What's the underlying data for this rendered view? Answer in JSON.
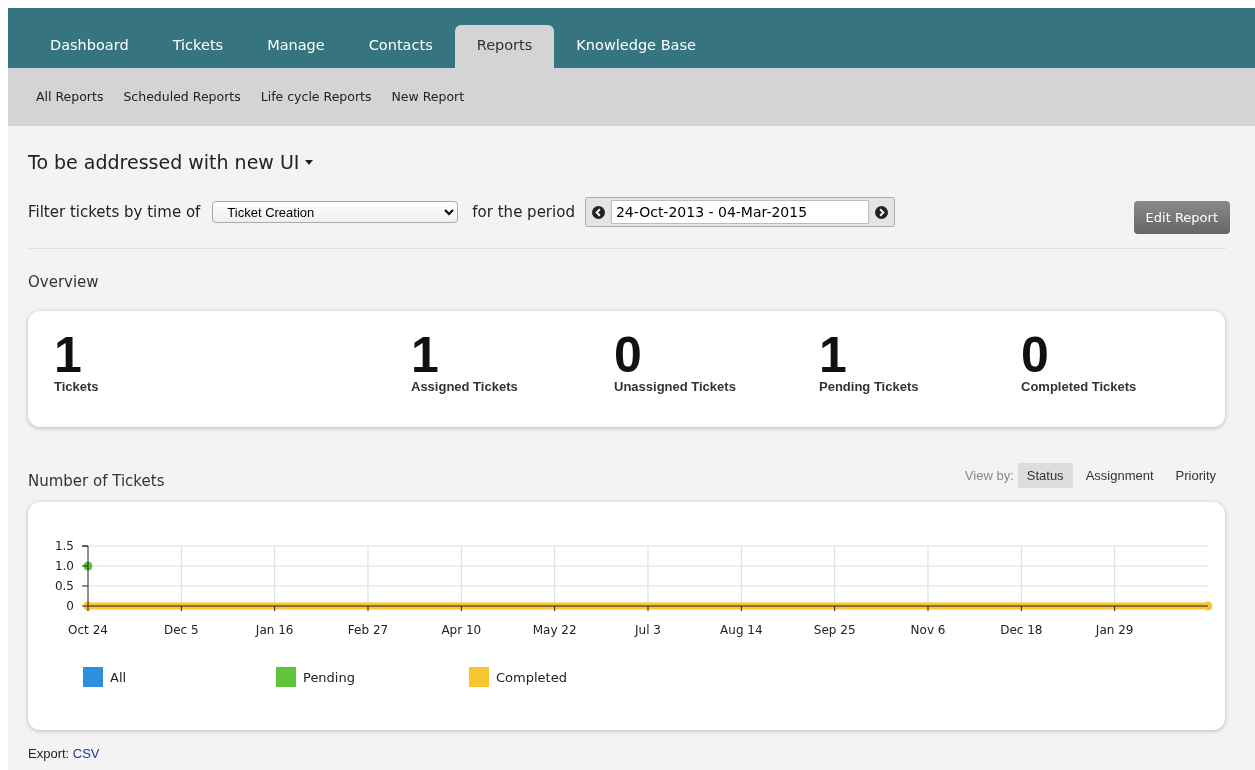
{
  "nav_tabs": [
    {
      "label": "Dashboard",
      "selected": false
    },
    {
      "label": "Tickets",
      "selected": false
    },
    {
      "label": "Manage",
      "selected": false
    },
    {
      "label": "Contacts",
      "selected": false
    },
    {
      "label": "Reports",
      "selected": true
    },
    {
      "label": "Knowledge Base",
      "selected": false
    }
  ],
  "sub_nav": [
    "All Reports",
    "Scheduled Reports",
    "Life cycle Reports",
    "New Report"
  ],
  "report_title": "To be addressed with new UI",
  "filter": {
    "label": "Filter tickets by time of",
    "select_value": "Ticket Creation",
    "period_label": "for the period",
    "period_value": "24-Oct-2013 - 04-Mar-2015"
  },
  "edit_button": "Edit Report",
  "overview": {
    "title": "Overview",
    "stats": [
      {
        "value": "1",
        "label": "Tickets"
      },
      {
        "value": "1",
        "label": "Assigned Tickets"
      },
      {
        "value": "0",
        "label": "Unassigned Tickets"
      },
      {
        "value": "1",
        "label": "Pending Tickets"
      },
      {
        "value": "0",
        "label": "Completed Tickets"
      }
    ]
  },
  "tickets_chart": {
    "title": "Number of Tickets",
    "view_by_label": "View by:",
    "view_options": [
      {
        "label": "Status",
        "selected": true
      },
      {
        "label": "Assignment",
        "selected": false
      },
      {
        "label": "Priority",
        "selected": false
      }
    ],
    "chart_data": {
      "type": "line",
      "categories": [
        "Oct 24",
        "Dec 5",
        "Jan 16",
        "Feb 27",
        "Apr 10",
        "May 22",
        "Jul 3",
        "Aug 14",
        "Sep 25",
        "Nov 6",
        "Dec 18",
        "Jan 29",
        null
      ],
      "ylim": [
        0,
        1.5
      ],
      "grid": true,
      "legend": true,
      "yticks": [
        0,
        0.5,
        {
          "value": 1,
          "label": "1.0"
        },
        1.5
      ],
      "series": [
        {
          "name": "All",
          "color": "#2e8fdd",
          "values": [
            null,
            null,
            null,
            null,
            null,
            null,
            null,
            null,
            null,
            null,
            null,
            null,
            null
          ]
        },
        {
          "name": "Pending",
          "color": "#5fc63a",
          "marker": true,
          "values": [
            1,
            null,
            null,
            null,
            null,
            null,
            null,
            null,
            null,
            null,
            null,
            null,
            null
          ]
        },
        {
          "name": "Completed",
          "color": "#f6c531",
          "marker": true,
          "values": [
            0,
            0,
            0,
            0,
            0,
            0,
            0,
            0,
            0,
            0,
            0,
            0,
            0
          ]
        }
      ]
    }
  },
  "export": {
    "label": "Export:",
    "link": "CSV"
  }
}
